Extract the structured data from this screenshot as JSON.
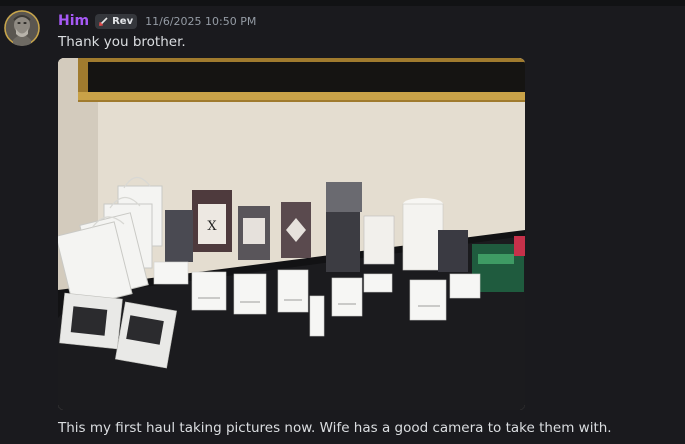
{
  "message_top": {
    "username": "Him",
    "role_tag": "Rev",
    "timestamp": "11/6/2025 10:50 PM",
    "text": "Thank you brother."
  },
  "attachment": {
    "type": "photo",
    "icon": "image-attachment"
  },
  "message_bottom": {
    "text": "This my first haul taking pictures now. Wife has a good camera to take them with."
  },
  "colors": {
    "background": "#1a1a1e",
    "username": "#a659f5",
    "text": "#dbdee1",
    "muted": "#949ba4",
    "role_tag_bg": "#35373c"
  }
}
